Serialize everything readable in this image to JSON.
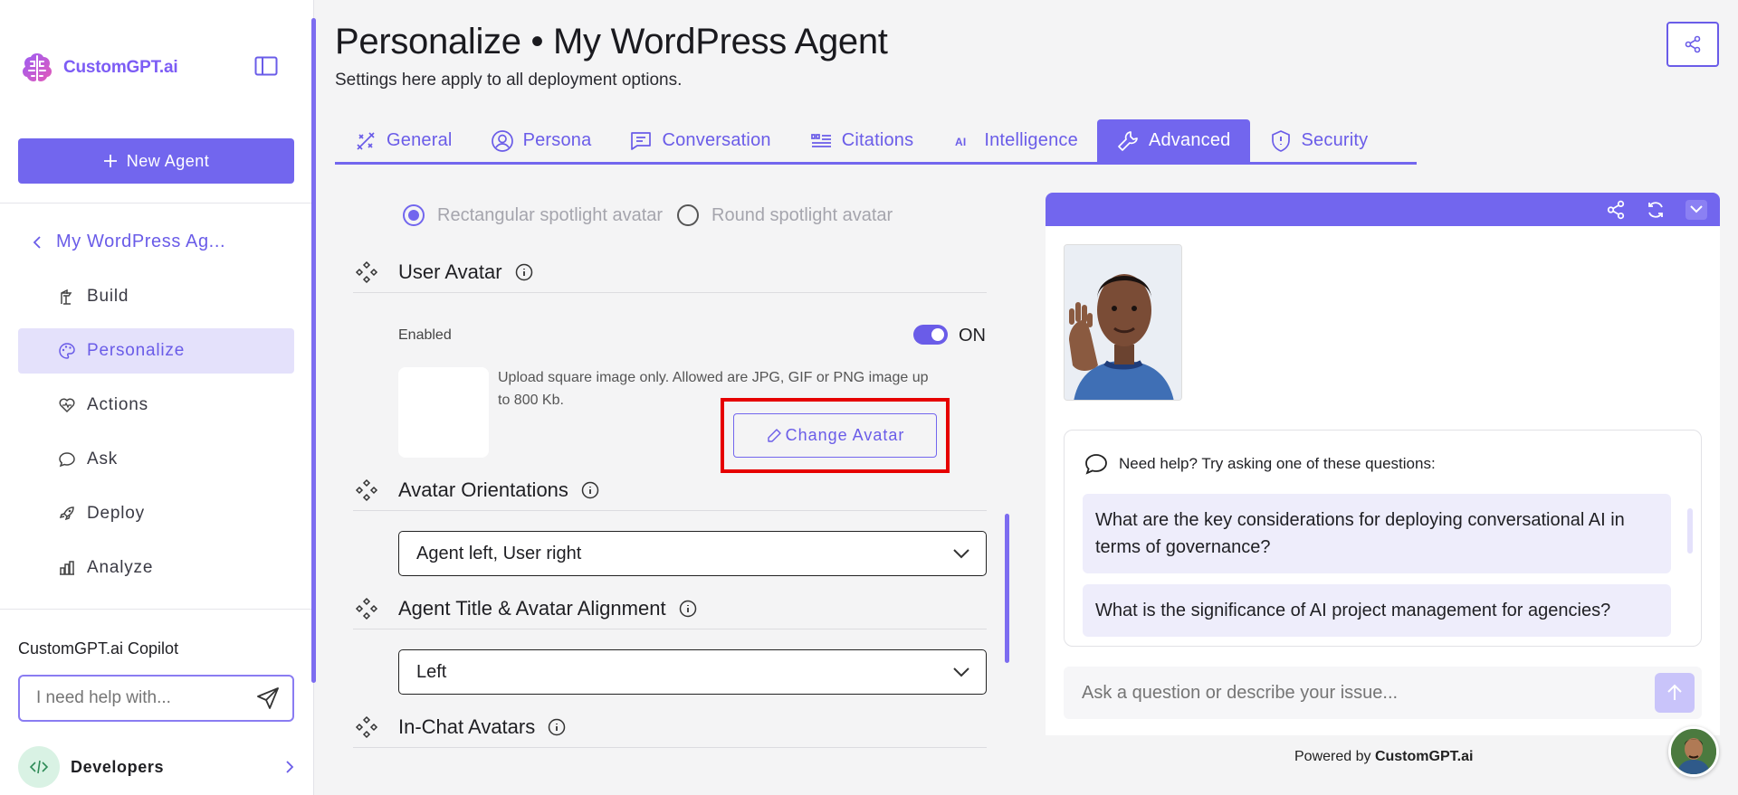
{
  "sidebar": {
    "logo_text": "CustomGPT.ai",
    "new_agent_label": "New Agent",
    "agent_name": "My WordPress Ag...",
    "items": [
      {
        "label": "Build",
        "icon": "build-icon",
        "active": false
      },
      {
        "label": "Personalize",
        "icon": "palette-icon",
        "active": true
      },
      {
        "label": "Actions",
        "icon": "actions-icon",
        "active": false
      },
      {
        "label": "Ask",
        "icon": "chat-icon",
        "active": false
      },
      {
        "label": "Deploy",
        "icon": "rocket-icon",
        "active": false
      },
      {
        "label": "Analyze",
        "icon": "bar-chart-icon",
        "active": false
      }
    ],
    "copilot_title": "CustomGPT.ai Copilot",
    "copilot_placeholder": "I need help with...",
    "developers_label": "Developers"
  },
  "header": {
    "title": "Personalize • My WordPress Agent",
    "subtitle": "Settings here apply to all deployment options."
  },
  "tabs": [
    {
      "label": "General",
      "icon": "general-icon",
      "active": false
    },
    {
      "label": "Persona",
      "icon": "persona-icon",
      "active": false
    },
    {
      "label": "Conversation",
      "icon": "conversation-icon",
      "active": false
    },
    {
      "label": "Citations",
      "icon": "citations-icon",
      "active": false
    },
    {
      "label": "Intelligence",
      "icon": "ai-icon",
      "active": false
    },
    {
      "label": "Advanced",
      "icon": "wrench-icon",
      "active": true
    },
    {
      "label": "Security",
      "icon": "shield-icon",
      "active": false
    }
  ],
  "settings": {
    "spotlight_options": [
      "Rectangular spotlight avatar",
      "Round spotlight avatar"
    ],
    "spotlight_selected": "Rectangular spotlight avatar",
    "user_avatar": {
      "title": "User Avatar",
      "enabled_label": "Enabled",
      "toggle_label": "ON",
      "upload_help": "Upload square image only. Allowed are JPG, GIF or PNG image up to 800 Kb.",
      "change_button": "Change Avatar"
    },
    "avatar_orientations": {
      "title": "Avatar Orientations",
      "value": "Agent left, User right"
    },
    "title_alignment": {
      "title": "Agent Title & Avatar Alignment",
      "value": "Left"
    },
    "in_chat_avatars": {
      "title": "In-Chat Avatars"
    }
  },
  "preview": {
    "questions_header": "Need help? Try asking one of these questions:",
    "questions": [
      "What are the key considerations for deploying conversational AI in terms of governance?",
      "What is the significance of AI project management for agencies?"
    ],
    "input_placeholder": "Ask a question or describe your issue...",
    "powered_prefix": "Powered by",
    "powered_brand": "CustomGPT.ai"
  },
  "colors": {
    "accent": "#7266ee",
    "accent_light": "#e4e1fb",
    "highlight": "#e60000"
  }
}
